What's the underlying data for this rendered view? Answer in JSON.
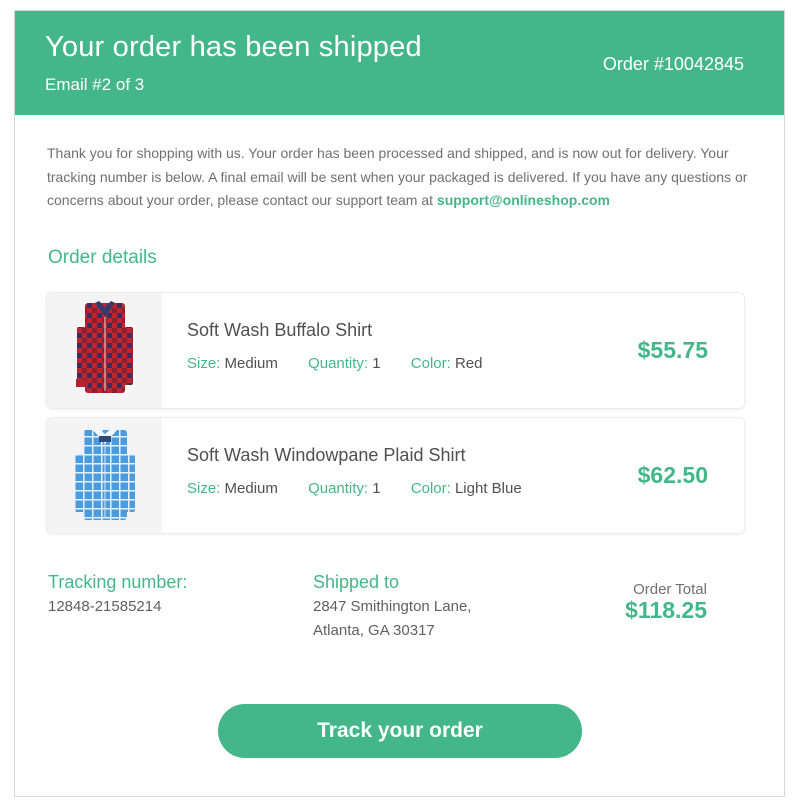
{
  "header": {
    "title": "Your order has been shipped",
    "subtitle": "Email #2 of 3",
    "order_number": "Order #10042845",
    "brand_color": "#43b789"
  },
  "intro": {
    "text": "Thank you for shopping with us. Your order has been processed and shipped, and is now out for delivery. Your tracking number is below. A final email will be sent when your packaged is delivered. If you have any questions or concerns about your order, please contact our support team at ",
    "support_email": "support@onlineshop.com"
  },
  "order_details": {
    "title": "Order details",
    "items": [
      {
        "name": "Soft Wash Buffalo Shirt",
        "size_label": "Size:",
        "size": "Medium",
        "quantity_label": "Quantity:",
        "quantity": "1",
        "color_label": "Color:",
        "color": "Red",
        "price": "$55.75",
        "image": "red-plaid-shirt-image"
      },
      {
        "name": "Soft Wash Windowpane Plaid Shirt",
        "size_label": "Size:",
        "size": "Medium",
        "quantity_label": "Quantity:",
        "quantity": "1",
        "color_label": "Color:",
        "color": "Light Blue",
        "price": "$62.50",
        "image": "blue-plaid-shirt-image"
      }
    ]
  },
  "tracking": {
    "label": "Tracking number:",
    "value": "12848-21585214"
  },
  "shipping": {
    "label": "Shipped to",
    "address_line1": "2847 Smithington Lane,",
    "address_line2": "Atlanta, GA 30317"
  },
  "total": {
    "label": "Order Total",
    "value": "$118.25"
  },
  "cta": {
    "label": "Track your order"
  }
}
